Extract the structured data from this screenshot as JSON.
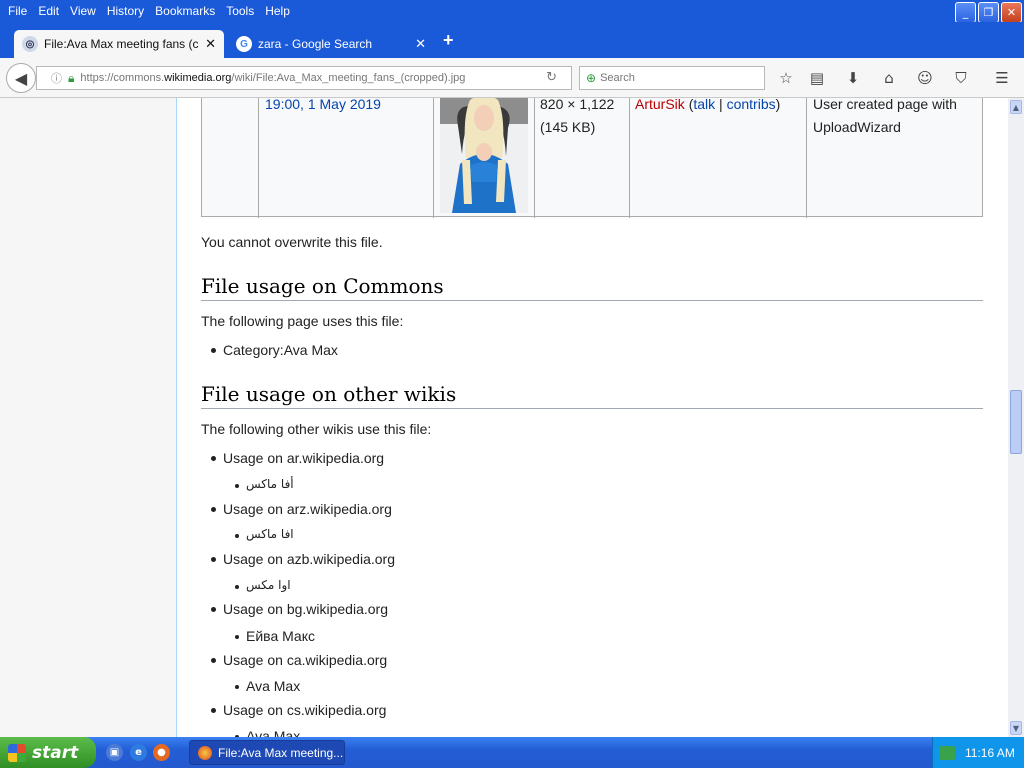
{
  "menubar": {
    "items": [
      "File",
      "Edit",
      "View",
      "History",
      "Bookmarks",
      "Tools",
      "Help"
    ]
  },
  "window_controls": {
    "minimize": "_",
    "restore": "❐",
    "close": "✕"
  },
  "tabs": [
    {
      "title": "File:Ava Max meeting fans (cr...",
      "close": "✕",
      "active": true
    },
    {
      "title": "zara - Google Search",
      "close": "✕",
      "active": false
    }
  ],
  "newtab_label": "+",
  "navbar": {
    "url_prefix": "https://commons.",
    "url_domain": "wikimedia.org",
    "url_path": "/wiki/File:Ava_Max_meeting_fans_(cropped).jpg",
    "search_placeholder": "Search"
  },
  "history_row": {
    "datetime": "19:00, 1 May 2019",
    "dimensions": "820 × 1,122",
    "size": "(145 KB)",
    "user": "ArturSik",
    "talk": "talk",
    "contribs": "contribs",
    "sep_open": "(",
    "sep_bar": "|",
    "sep_close": ")",
    "comment_line1": "User created page with",
    "comment_line2": "UploadWizard"
  },
  "overwrite_note": "You cannot overwrite this file.",
  "commons_usage": {
    "heading": "File usage on Commons",
    "intro": "The following page uses this file:",
    "pages": [
      "Category:Ava Max"
    ]
  },
  "other_wikis": {
    "heading": "File usage on other wikis",
    "intro": "The following other wikis use this file:",
    "wikis": [
      {
        "label": "Usage on ar.wikipedia.org",
        "page": "أفا ماكس"
      },
      {
        "label": "Usage on arz.wikipedia.org",
        "page": "افا ماكس"
      },
      {
        "label": "Usage on azb.wikipedia.org",
        "page": "اوا مکس"
      },
      {
        "label": "Usage on bg.wikipedia.org",
        "page": "Ейва Макс"
      },
      {
        "label": "Usage on ca.wikipedia.org",
        "page": "Ava Max"
      },
      {
        "label": "Usage on cs.wikipedia.org",
        "page": "Ava Max"
      }
    ]
  },
  "taskbar": {
    "start_label": "start",
    "task_title": "File:Ava Max meeting...",
    "clock": "11:16 AM"
  }
}
